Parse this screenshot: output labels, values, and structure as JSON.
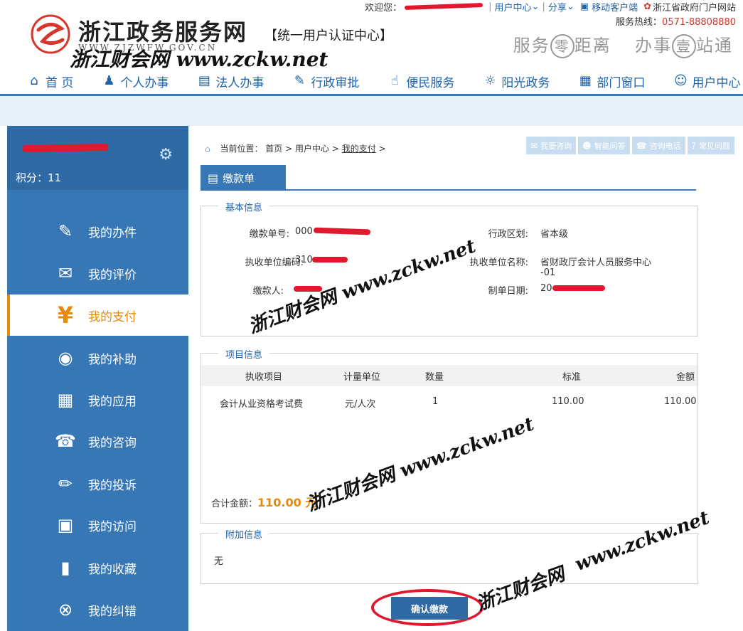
{
  "topbar": {
    "welcome": "欢迎您：",
    "user_center": "用户中心",
    "share": "分享",
    "mobile": "移动客户端",
    "portal": "浙江省政府门户网站",
    "hotline_label": "服务热线：",
    "hotline_number": "0571-88808880"
  },
  "brand": {
    "site_name": "浙江政务服务网",
    "site_url": "WWW.ZJZWFW.GOV.CN",
    "auth_center": "【统一用户认证中心】",
    "slogan_a": "服务",
    "slogan_circle1": "零",
    "slogan_b": "距离",
    "slogan_c": "办事",
    "slogan_circle2": "壹",
    "slogan_d": "站通"
  },
  "watermark": {
    "text": "浙江财会网  www.zckw.net",
    "line1": "浙江财会网",
    "line2": "www.zckw.net"
  },
  "nav": [
    "首 页",
    "个人办事",
    "法人办事",
    "行政审批",
    "便民服务",
    "阳光政务",
    "部门窗口",
    "用户中心"
  ],
  "sidebar": {
    "score": "积分：11",
    "items": [
      "我的办件",
      "我的评价",
      "我的支付",
      "我的补助",
      "我的应用",
      "我的咨询",
      "我的投诉",
      "我的访问",
      "我的收藏",
      "我的纠错"
    ]
  },
  "breadcrumb": {
    "label": "当前位置：",
    "home": "首页",
    "user_center": "用户中心",
    "current": "我的支付",
    "sep": ">"
  },
  "tools": [
    "我要咨询",
    "智能问答",
    "咨询电话",
    "常见问题"
  ],
  "page_title": "缴款单",
  "basic_info": {
    "legend": "基本信息",
    "payment_no_label": "缴款单号:",
    "payment_no_value": "000",
    "region_label": "行政区划:",
    "region_value": "省本级",
    "unit_code_label": "执收单位编码:",
    "unit_code_value": "310",
    "unit_name_label": "执收单位名称:",
    "unit_name_value_1": "省财政厅会计人员服务中心",
    "unit_name_value_2": "-01",
    "payer_label": "缴款人:",
    "date_label": "制单日期:",
    "date_value": "20"
  },
  "items_info": {
    "legend": "项目信息",
    "columns": [
      "执收项目",
      "计量单位",
      "数量",
      "标准",
      "金额"
    ],
    "rows": [
      {
        "item": "会计从业资格考试费",
        "unit": "元/人次",
        "qty": "1",
        "standard": "110.00",
        "amount": "110.00"
      }
    ],
    "total_label": "合计金额：",
    "total_value": "110.00 元"
  },
  "extra_info": {
    "legend": "附加信息",
    "value": "无"
  },
  "confirm_label": "确认缴款"
}
